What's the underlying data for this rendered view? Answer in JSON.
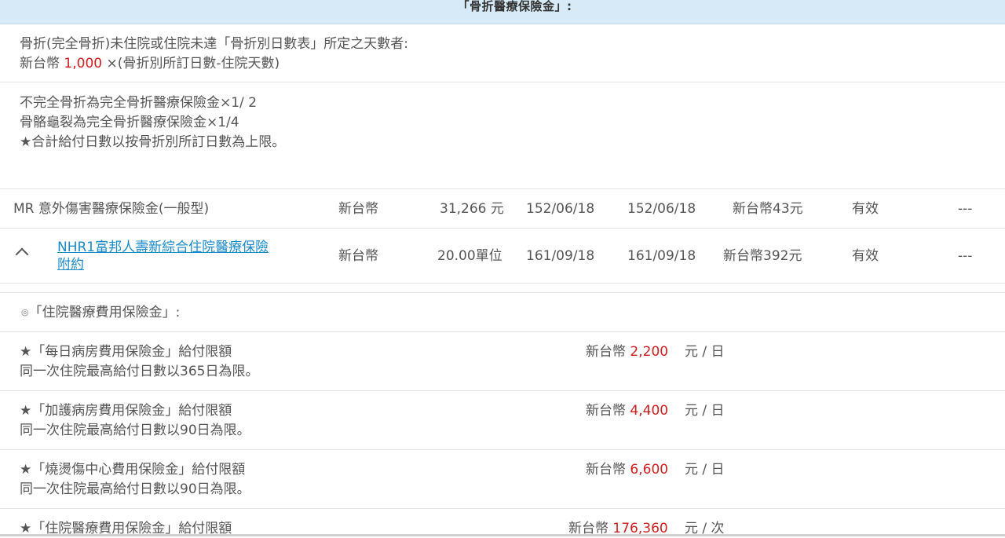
{
  "header": {
    "section_title": "「骨折醫療保險金」:"
  },
  "fracture": {
    "line1": "骨折(完全骨折)未住院或住院未達「骨折別日數表」所定之天數者:",
    "line2_prefix": "新台幣 ",
    "line2_amount": "1,000",
    "line2_suffix": " ×(骨折別所訂日數-住院天數)",
    "note1": "不完全骨折為完全骨折醫療保險金×1/ 2",
    "note2": "骨骼龜裂為完全骨折醫療保險金×1/4",
    "note3": "★合計給付日數以按骨折別所訂日數為上限。"
  },
  "policies": [
    {
      "name": "MR 意外傷害醫療保險金(一般型)",
      "currency": "新台幣",
      "amount": "31,266 元",
      "start": "152/06/18",
      "end": "152/06/18",
      "premium": "新台幣43元",
      "status": "有效",
      "extra": "---"
    },
    {
      "name_line1": "NHR1富邦人壽新綜合住院醫療保險",
      "name_line2": "附約",
      "currency": "新台幣",
      "amount": "20.00單位",
      "start": "161/09/18",
      "end": "161/09/18",
      "premium": "新台幣392元",
      "status": "有效",
      "extra": "---",
      "expand_icon": "chevron-up-icon"
    }
  ],
  "hospital": {
    "heading_bullet": "◎",
    "heading": "「住院醫療費用保險金」:",
    "items": [
      {
        "title": "★「每日病房費用保險金」給付限額",
        "sub": "同一次住院最高給付日數以365日為限。",
        "prefix": "新台幣 ",
        "amount": "2,200",
        "unit": "元 / 日"
      },
      {
        "title": "★「加護病房費用保險金」給付限額",
        "sub": "同一次住院最高給付日數以90日為限。",
        "prefix": "新台幣 ",
        "amount": "4,400",
        "unit": "元 / 日"
      },
      {
        "title": "★「燒燙傷中心費用保險金」給付限額",
        "sub": "同一次住院最高給付日數以90日為限。",
        "prefix": "新台幣 ",
        "amount": "6,600",
        "unit": "元 / 日"
      },
      {
        "title": "★「住院醫療費用保險金」給付限額",
        "prefix": "新台幣 ",
        "amount": "176,360",
        "unit": "元 / 次"
      }
    ]
  },
  "colors": {
    "header_bg": "#d6ebf7",
    "amount_red": "#cc1f1f",
    "link_blue": "#1a8ac7"
  }
}
